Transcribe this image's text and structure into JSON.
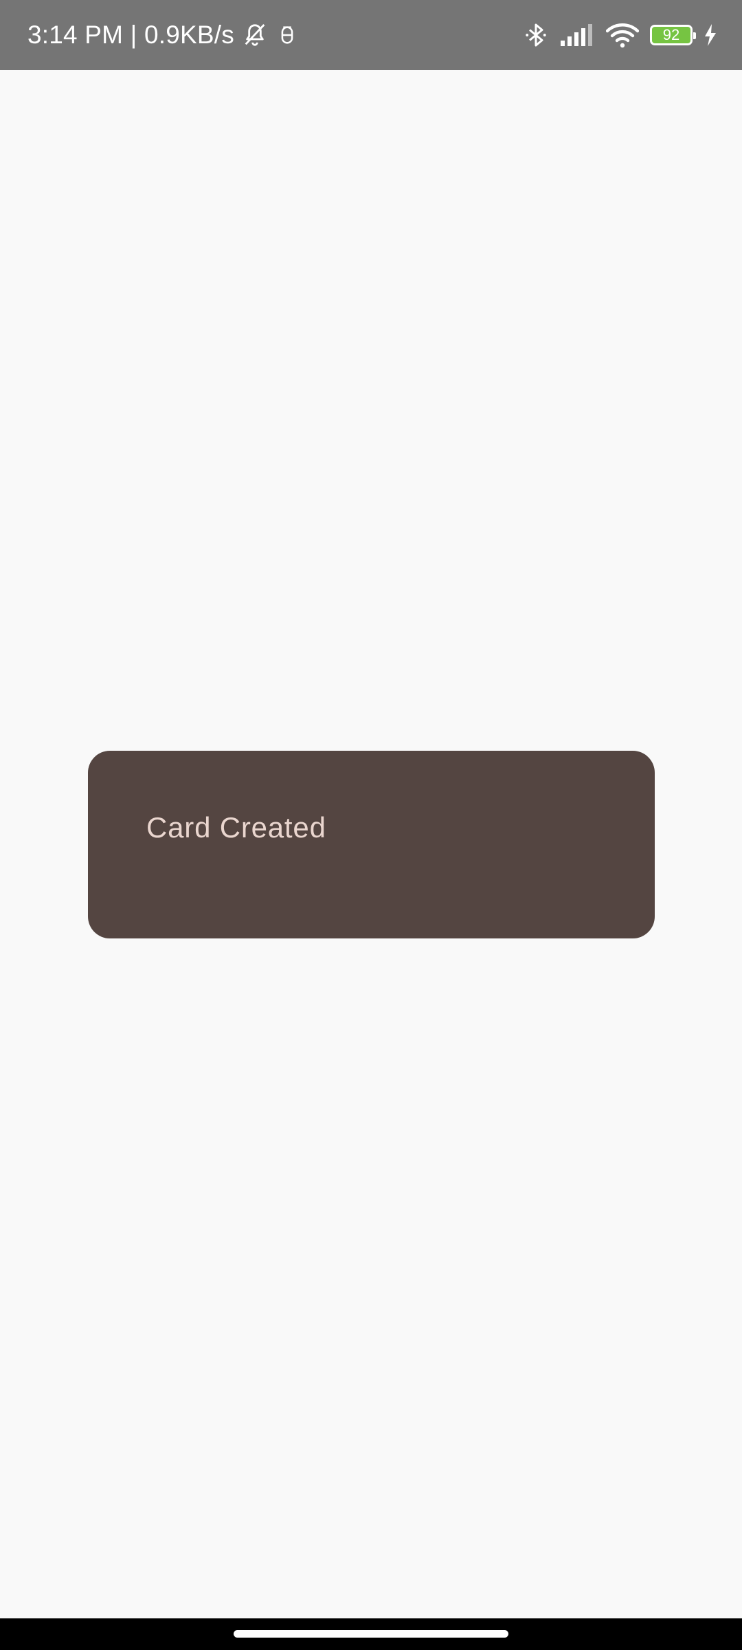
{
  "status_bar": {
    "time_speed": "3:14 PM | 0.9KB/s",
    "battery_level": "92",
    "icons": {
      "left": [
        "bell-off-icon",
        "data-saver-icon"
      ],
      "right": [
        "bluetooth-icon",
        "cellular-signal-icon",
        "wifi-icon",
        "battery-icon",
        "charging-bolt-icon"
      ]
    },
    "battery_color": "#76c442",
    "background": "#757575"
  },
  "card": {
    "title": "Card Created",
    "background": "#544541",
    "text_color": "#ead6cf"
  },
  "page": {
    "background": "#f9f9f9"
  }
}
